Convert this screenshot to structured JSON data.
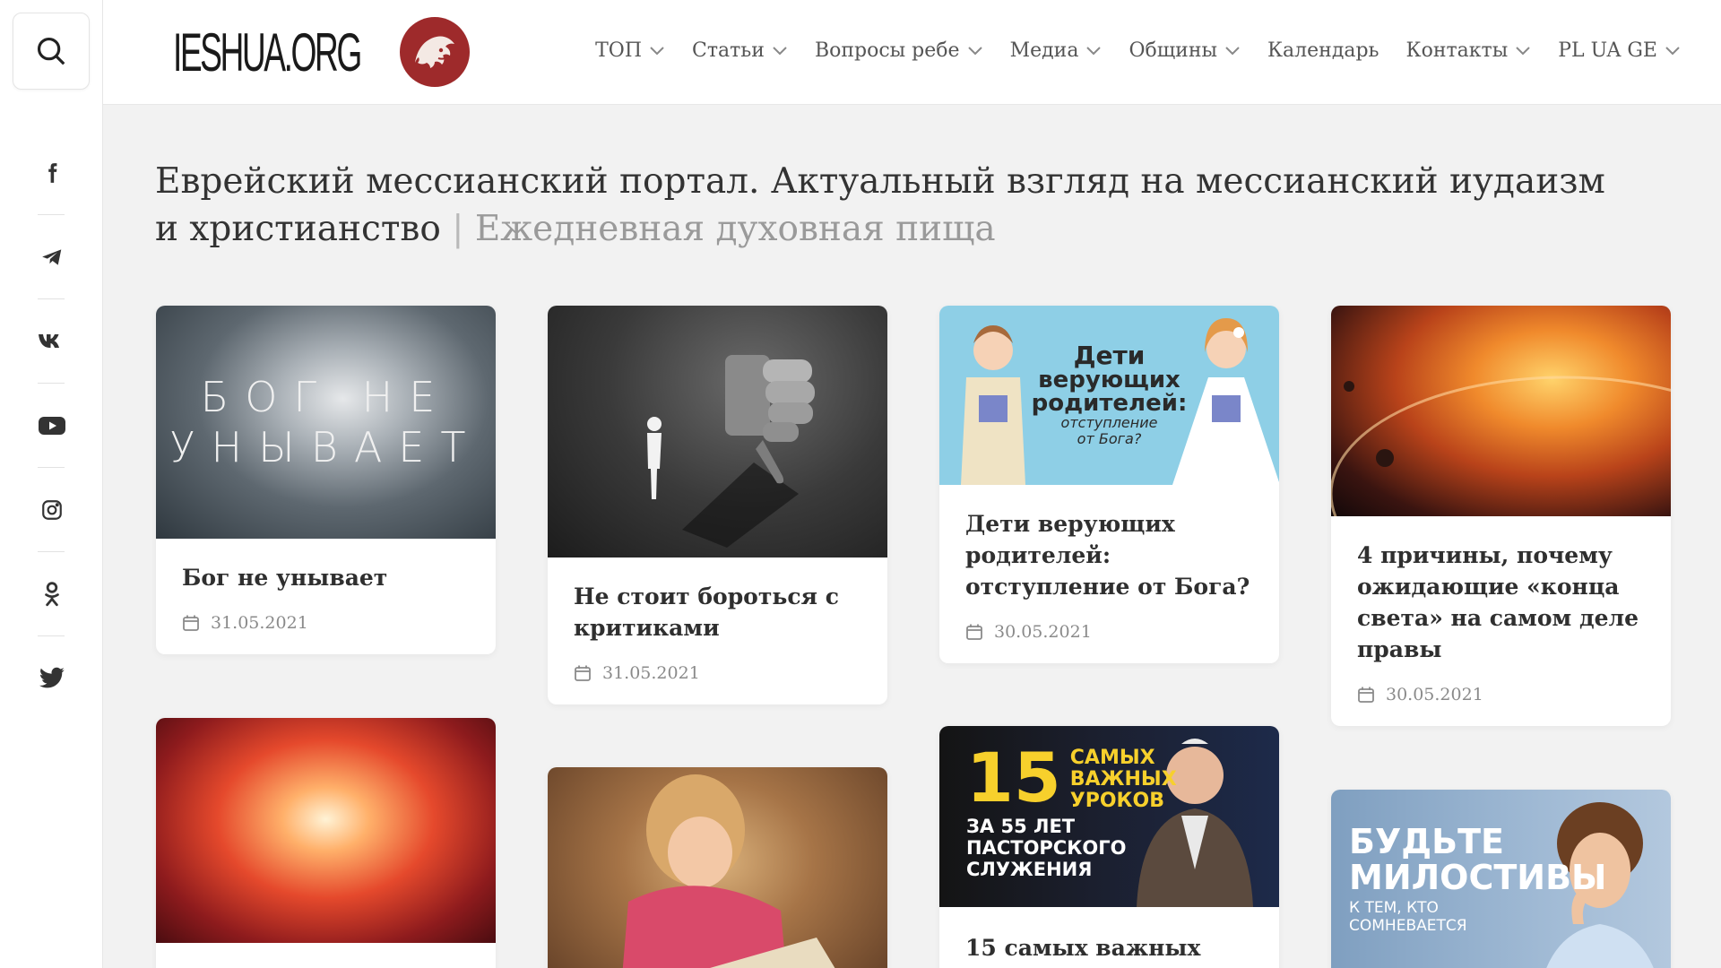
{
  "header": {
    "logo_text": "IESHUA.ORG",
    "nav": [
      {
        "label": "ТОП",
        "has_dropdown": true
      },
      {
        "label": "Статьи",
        "has_dropdown": true
      },
      {
        "label": "Вопросы ребе",
        "has_dropdown": true
      },
      {
        "label": "Медиа",
        "has_dropdown": true
      },
      {
        "label": "Общины",
        "has_dropdown": true
      },
      {
        "label": "Календарь",
        "has_dropdown": false
      },
      {
        "label": "Контакты",
        "has_dropdown": true
      },
      {
        "label": "PL UA GE",
        "has_dropdown": true
      }
    ]
  },
  "sidebar": {
    "search_icon": "search-icon",
    "social": [
      "facebook-icon",
      "telegram-icon",
      "vk-icon",
      "youtube-icon",
      "instagram-icon",
      "odnoklassniki-icon",
      "twitter-icon"
    ]
  },
  "page": {
    "title": "Еврейский мессианский портал. Актуальный взгляд на мессианский иудаизм и христианство",
    "separator": "|",
    "subtitle": "Ежедневная духовная пища"
  },
  "cards": [
    {
      "title": "Бог не унывает",
      "date": "31.05.2021",
      "image_text": [
        "БОГ НЕ",
        "УНЫВАЕТ"
      ]
    },
    {
      "title": "Не стоит бороться с критиками",
      "date": "31.05.2021"
    },
    {
      "title": "Дети верующих родителей: отступление от Бога?",
      "date": "30.05.2021",
      "image_text": [
        "Дети",
        "верующих",
        "родителей:",
        "отступление",
        "от Бога?"
      ]
    },
    {
      "title": "4 причины, почему ожидающие «конца света» на самом деле правы",
      "date": "30.05.2021"
    },
    {
      "title": "15 самых важных",
      "image_text": [
        "15",
        "САМЫХ",
        "ВАЖНЫХ",
        "УРОКОВ",
        "ЗА 55 ЛЕТ",
        "ПАСТОРСКОГО",
        "СЛУЖЕНИЯ"
      ]
    },
    {
      "image_text": [
        "БУДЬТЕ",
        "МИЛОСТИВЫ",
        "К ТЕМ, КТО",
        "СОМНЕВАЕТСЯ"
      ]
    }
  ],
  "colors": {
    "accent": "#9e2a2b",
    "background": "#f2f2f2"
  }
}
